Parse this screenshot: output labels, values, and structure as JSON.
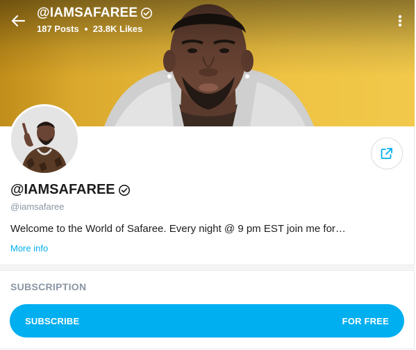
{
  "header": {
    "title": "@IAMSAFAREE",
    "posts": "187 Posts",
    "likes": "23.8K Likes"
  },
  "profile": {
    "display_name": "@IAMSAFAREE",
    "handle": "@iamsafaree",
    "bio": "Welcome to the World of Safaree. Every night @ 9 pm EST join me for…",
    "more_info": "More info"
  },
  "subscription": {
    "section_title": "SUBSCRIPTION",
    "button_label": "SUBSCRIBE",
    "price_label": "FOR FREE"
  },
  "icons": {
    "back": "back-arrow-icon",
    "verified": "verified-badge-icon",
    "more": "more-vertical-icon",
    "share": "share-icon"
  },
  "colors": {
    "accent": "#00aff0",
    "muted": "#8a96a3",
    "cover_yellow": "#efc343"
  }
}
